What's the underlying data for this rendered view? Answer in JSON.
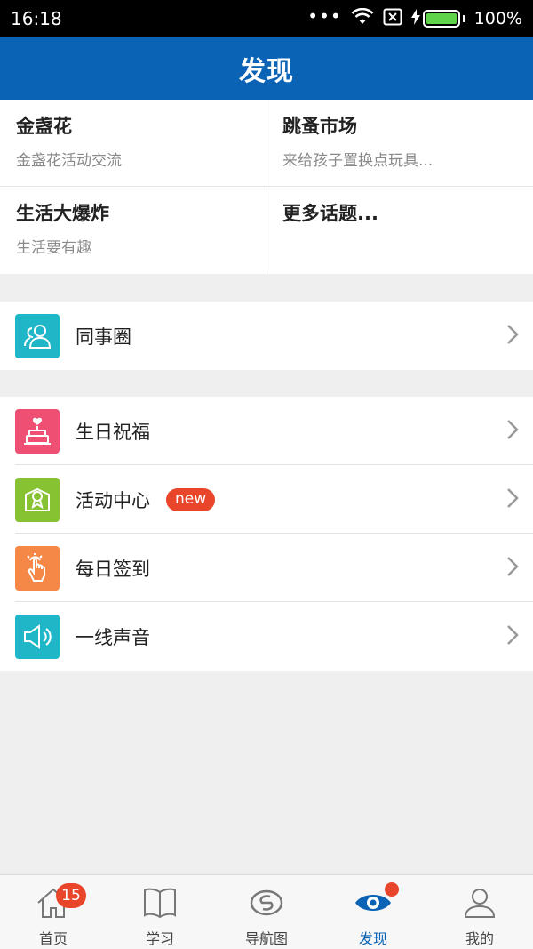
{
  "status_bar": {
    "time": "16:18",
    "dots": "•••",
    "battery_percent": "100%"
  },
  "header": {
    "title": "发现"
  },
  "topics": [
    {
      "title": "金盏花",
      "subtitle": "金盏花活动交流"
    },
    {
      "title": "跳蚤市场",
      "subtitle": "来给孩子置换点玩具..."
    },
    {
      "title": "生活大爆炸",
      "subtitle": "生活要有趣"
    },
    {
      "title": "更多话题...",
      "subtitle": ""
    }
  ],
  "section1": {
    "items": [
      {
        "label": "同事圈",
        "icon": "colleagues-icon",
        "color": "#1fb6c8"
      }
    ]
  },
  "section2": {
    "items": [
      {
        "label": "生日祝福",
        "icon": "birthday-cake-icon",
        "color": "#ee4f72"
      },
      {
        "label": "活动中心",
        "icon": "activity-badge-icon",
        "color": "#86c232",
        "badge": "new"
      },
      {
        "label": "每日签到",
        "icon": "tap-hand-icon",
        "color": "#f58747"
      },
      {
        "label": "一线声音",
        "icon": "megaphone-icon",
        "color": "#1fb6c8"
      }
    ]
  },
  "tabs": [
    {
      "label": "首页",
      "icon": "home-icon",
      "badge": "15"
    },
    {
      "label": "学习",
      "icon": "book-icon"
    },
    {
      "label": "导航图",
      "icon": "navigation-map-icon"
    },
    {
      "label": "发现",
      "icon": "eye-icon",
      "active": true
    },
    {
      "label": "我的",
      "icon": "profile-icon"
    }
  ],
  "colors": {
    "primary": "#0a63b5",
    "badge": "#e8452b",
    "background": "#efefef"
  }
}
